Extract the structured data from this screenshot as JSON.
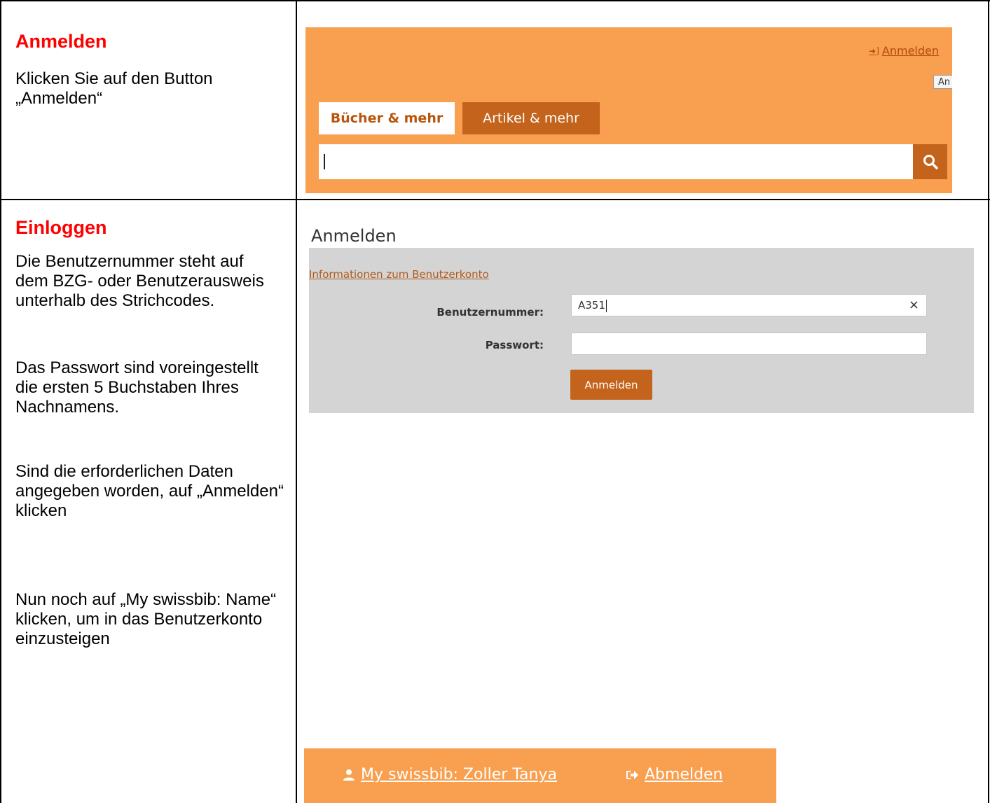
{
  "rows": [
    {
      "heading": "Anmelden",
      "paragraphs": [
        "Klicken Sie auf den Button „Anmelden“"
      ]
    },
    {
      "heading": "Einloggen",
      "paragraphs": [
        "Die Benutzernummer steht auf dem BZG-  oder Benutzerausweis unterhalb des Strichcodes.",
        "Das Passwort sind voreingestellt die ersten 5 Buchstaben Ihres Nachnamens.",
        "Sind die erforderlichen Daten angegeben worden, auf „Anmelden“ klicken",
        "Nun noch auf „My swissbib: Name“ klicken, um in das Benutzerkonto einzusteigen"
      ]
    }
  ],
  "header_screenshot": {
    "login_link": "Anmelden",
    "login_icon": "sign-in-icon",
    "partial_button": "An",
    "tabs": [
      {
        "label": "Bücher & mehr",
        "active": true
      },
      {
        "label": "Artikel & mehr",
        "active": false
      }
    ],
    "search_value": "",
    "search_icon": "search-icon",
    "brand_color": "#f9a050",
    "accent_color": "#c3631c"
  },
  "login_form": {
    "title": "Anmelden",
    "info_link": "Informationen zum Benutzerkonto",
    "username_label": "Benutzernummer:",
    "username_value": "A351",
    "password_label": "Passwort:",
    "password_value": "",
    "clear_icon": "close-icon",
    "submit_label": "Anmelden"
  },
  "account_bar": {
    "account_link": "My swissbib: Zoller Tanya",
    "account_icon": "user-icon",
    "logout_link": "Abmelden",
    "logout_icon": "sign-out-icon"
  }
}
